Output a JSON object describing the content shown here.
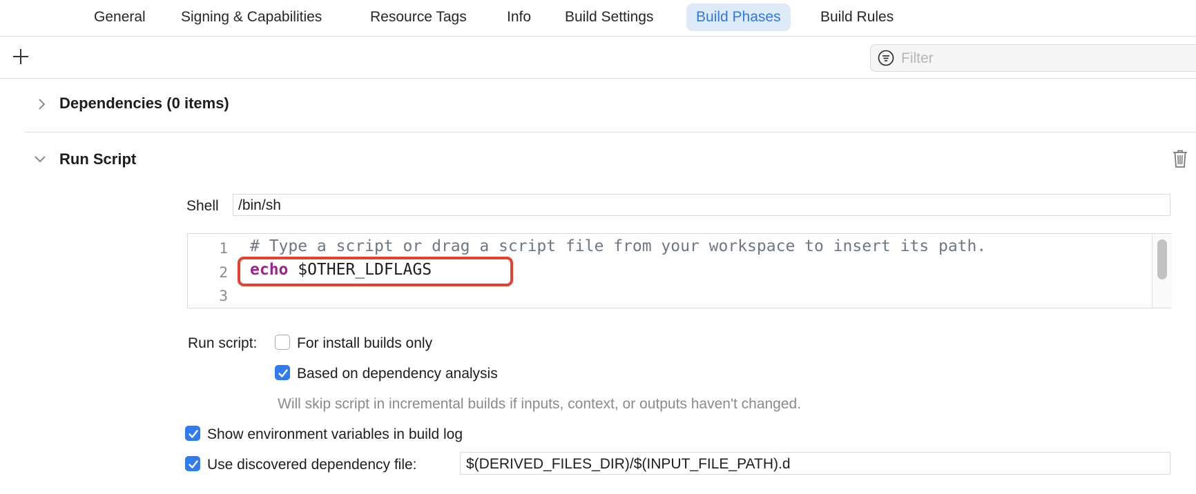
{
  "tabs": [
    "General",
    "Signing & Capabilities",
    "Resource Tags",
    "Info",
    "Build Settings",
    "Build Phases",
    "Build Rules"
  ],
  "active_tab": "Build Phases",
  "toolbar": {
    "add_icon": "plus-icon",
    "filter_placeholder": "Filter",
    "filter_icon": "filter-icon"
  },
  "dependencies": {
    "title": "Dependencies (0 items)",
    "expanded": false
  },
  "run_script": {
    "title": "Run Script",
    "expanded": true,
    "shell_label": "Shell",
    "shell_value": "/bin/sh",
    "script_lines": [
      {
        "number": "1",
        "text": "# Type a script or drag a script file from your workspace to insert its path."
      },
      {
        "number": "2",
        "keyword": "echo",
        "text": " $OTHER_LDFLAGS"
      },
      {
        "number": "3",
        "text": ""
      }
    ],
    "options_label": "Run script:",
    "install_builds_only": {
      "label": "For install builds only",
      "checked": false
    },
    "dependency_analysis": {
      "label": "Based on dependency analysis",
      "checked": true
    },
    "dependency_hint": "Will skip script in incremental builds if inputs, context, or outputs haven't changed.",
    "show_env_vars": {
      "label": "Show environment variables in build log",
      "checked": true
    },
    "use_dep_file": {
      "label": "Use discovered dependency file:",
      "checked": true,
      "value": "$(DERIVED_FILES_DIR)/$(INPUT_FILE_PATH).d"
    }
  },
  "colors": {
    "accent": "#2f7cf0",
    "active_tab_bg": "#dfeaf9",
    "annotation": "#e8402f",
    "keyword": "#9b2393"
  }
}
